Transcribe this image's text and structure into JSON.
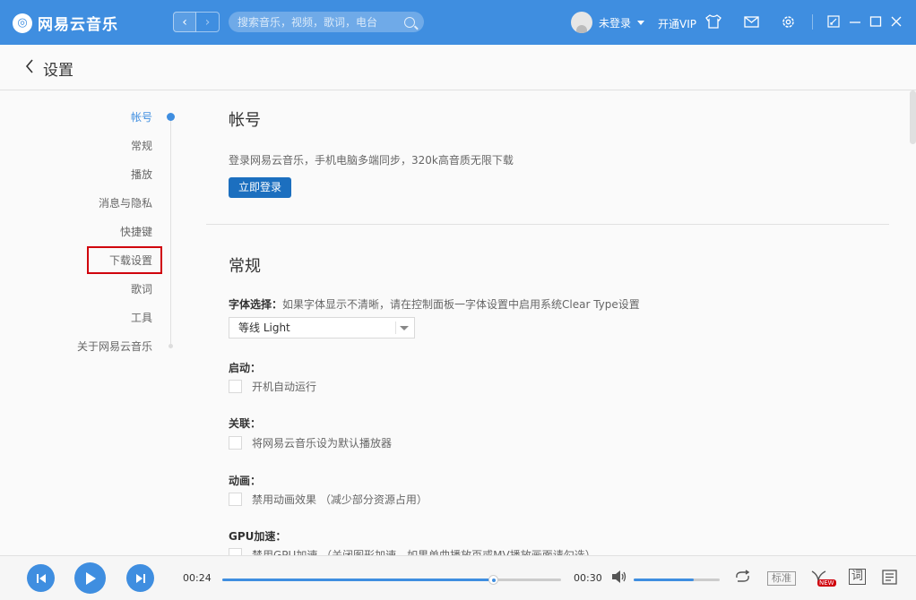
{
  "app": {
    "name": "网易云音乐",
    "accent_color": "#3f8ee0"
  },
  "topbar": {
    "search_placeholder": "搜索音乐，视频，歌词，电台",
    "user_name": "未登录",
    "vip_label": "开通VIP",
    "icons": [
      "skin-icon",
      "mail-icon",
      "settings-icon",
      "mini-mode-icon",
      "minimize-icon",
      "maximize-icon",
      "close-icon"
    ]
  },
  "header": {
    "title": "设置"
  },
  "sidebar": {
    "items": [
      {
        "label": "帐号",
        "active": true
      },
      {
        "label": "常规"
      },
      {
        "label": "播放"
      },
      {
        "label": "消息与隐私"
      },
      {
        "label": "快捷键"
      },
      {
        "label": "下载设置",
        "highlighted": true
      },
      {
        "label": "歌词"
      },
      {
        "label": "工具"
      },
      {
        "label": "关于网易云音乐"
      }
    ]
  },
  "account": {
    "title": "帐号",
    "desc": "登录网易云音乐，手机电脑多端同步，320k高音质无限下载",
    "login_button": "立即登录"
  },
  "general": {
    "title": "常规",
    "font_label": "字体选择：",
    "font_hint": "如果字体显示不清晰，请在控制面板一字体设置中启用系统Clear Type设置",
    "font_value": "等线 Light",
    "startup_label": "启动：",
    "startup_option": "开机自动运行",
    "assoc_label": "关联：",
    "assoc_option": "将网易云音乐设为默认播放器",
    "anim_label": "动画：",
    "anim_option": "禁用动画效果 （减少部分资源占用）",
    "gpu_label": "GPU加速：",
    "gpu_option": "禁用GPU加速 （关闭图形加速，如果单曲播放页或MV播放画面请勾选）"
  },
  "player": {
    "current_time": "00:24",
    "total_time": "00:30",
    "progress": 0.8,
    "volume": 0.7,
    "quality_label": "标准",
    "new_badge": "NEW",
    "lyrics_label": "词"
  }
}
